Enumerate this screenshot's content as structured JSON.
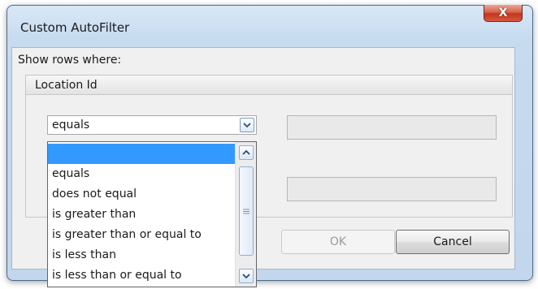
{
  "window": {
    "title": "Custom AutoFilter",
    "close_glyph": "X"
  },
  "filter": {
    "instruction": "Show rows where:",
    "column_name": "Location Id",
    "operator_selected": "equals",
    "value1": "",
    "value2": ""
  },
  "dropdown": {
    "options": [
      "",
      "equals",
      "does not equal",
      "is greater than",
      "is greater than or equal to",
      "is less than",
      "is less than or equal to"
    ],
    "highlighted_index": 0
  },
  "buttons": {
    "ok": "OK",
    "cancel": "Cancel"
  },
  "colors": {
    "selection": "#3399ff",
    "close_red": "#c1361e",
    "frame": "#c7dbef"
  }
}
